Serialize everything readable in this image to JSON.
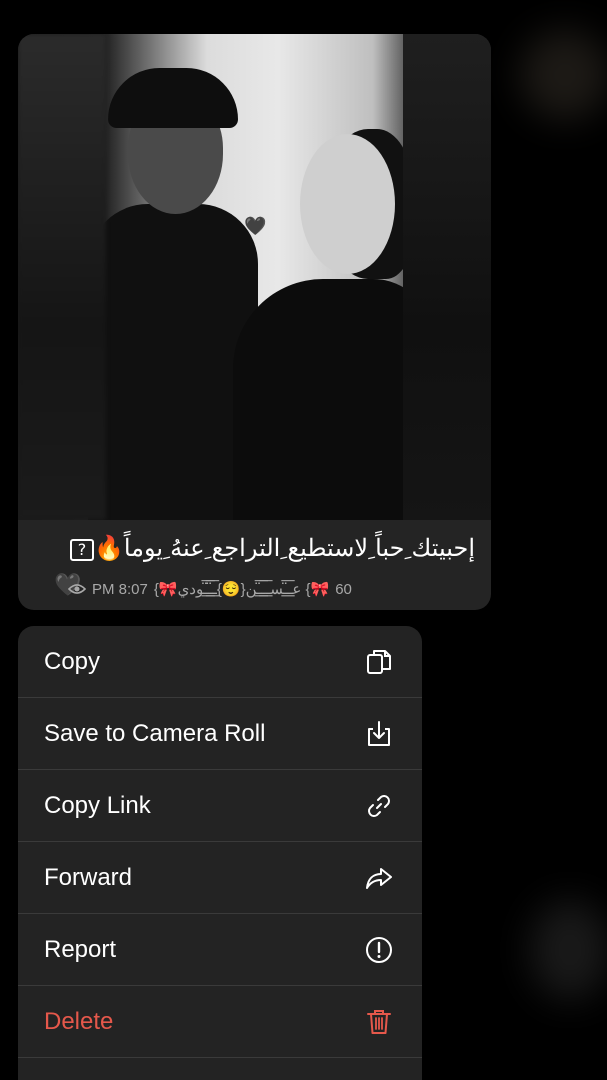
{
  "message": {
    "caption": "إحبيتك ِحباً ِلاستطيع ِالتراجع ِعنهُ ِيوماً",
    "caption_emoji": "🔥",
    "caption_box": "?",
    "heart_in_photo": "🖤",
    "meta_prefix": "60",
    "sender_name": "{🎀عـ̈͟͞ـسـ͟͞ـ̈͟͞ـن{😌}ـ̈͟͞ـ̈͟͞ـودي {🎀",
    "time": "PM 8:07",
    "meta_heart": "🖤"
  },
  "menu": {
    "items": [
      {
        "label": "Copy",
        "icon": "copy-icon"
      },
      {
        "label": "Save to Camera Roll",
        "icon": "save-download-icon"
      },
      {
        "label": "Copy Link",
        "icon": "link-icon"
      },
      {
        "label": "Forward",
        "icon": "forward-arrow-icon"
      },
      {
        "label": "Report",
        "icon": "exclamation-circle-icon"
      },
      {
        "label": "Delete",
        "icon": "trash-icon"
      }
    ]
  },
  "colors": {
    "background": "#000000",
    "menu_bg": "#232323",
    "danger": "#e5584b"
  }
}
